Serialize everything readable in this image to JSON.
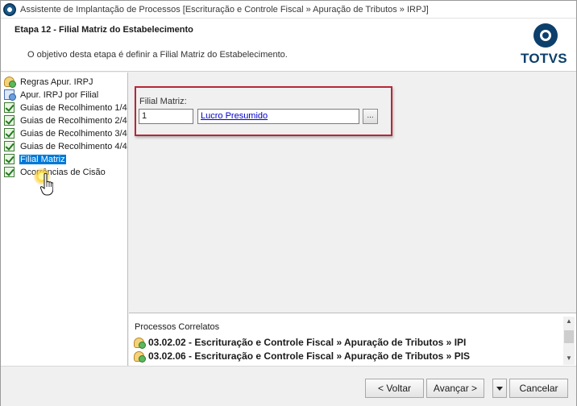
{
  "window": {
    "title": "Assistente de Implantação de Processos [Escrituração e Controle Fiscal » Apuração de Tributos » IRPJ]"
  },
  "header": {
    "step_title": "Etapa 12 - Filial Matriz do Estabelecimento",
    "step_description": "O objetivo desta etapa é definir a Filial Matriz do Estabelecimento.",
    "logo_text": "TOTVS"
  },
  "sidebar": {
    "items": [
      {
        "label": "Regras Apur. IRPJ",
        "icon": "person-check-icon",
        "selected": false
      },
      {
        "label": "Apur. IRPJ por Filial",
        "icon": "document-person-icon",
        "selected": false
      },
      {
        "label": "Guias de Recolhimento 1/4",
        "icon": "checkbox-checked-icon",
        "selected": false
      },
      {
        "label": "Guias de Recolhimento 2/4",
        "icon": "checkbox-checked-icon",
        "selected": false
      },
      {
        "label": "Guias de Recolhimento 3/4",
        "icon": "checkbox-checked-icon",
        "selected": false
      },
      {
        "label": "Guias de Recolhimento 4/4",
        "icon": "checkbox-checked-icon",
        "selected": false
      },
      {
        "label": "Filial Matriz",
        "icon": "checkbox-checked-icon",
        "selected": true
      },
      {
        "label": "Ocorrências de Cisão",
        "icon": "checkbox-checked-icon",
        "selected": false
      }
    ]
  },
  "form": {
    "field_label": "Filial Matriz:",
    "code_value": "1",
    "name_value": "Lucro Presumido",
    "lookup_label": "..."
  },
  "related": {
    "title": "Processos Correlatos",
    "items": [
      {
        "text": "03.02.02 - Escrituração e Controle Fiscal » Apuração de Tributos » IPI"
      },
      {
        "text": "03.02.06 - Escrituração e Controle Fiscal » Apuração de Tributos » PIS"
      }
    ]
  },
  "footer": {
    "back_label": "< Voltar",
    "next_label": "Avançar >",
    "cancel_label": "Cancelar"
  },
  "colors": {
    "selection": "#0078d7",
    "highlight_border": "#b5283a",
    "brand": "#0c3f6b",
    "link": "#0000cc"
  }
}
